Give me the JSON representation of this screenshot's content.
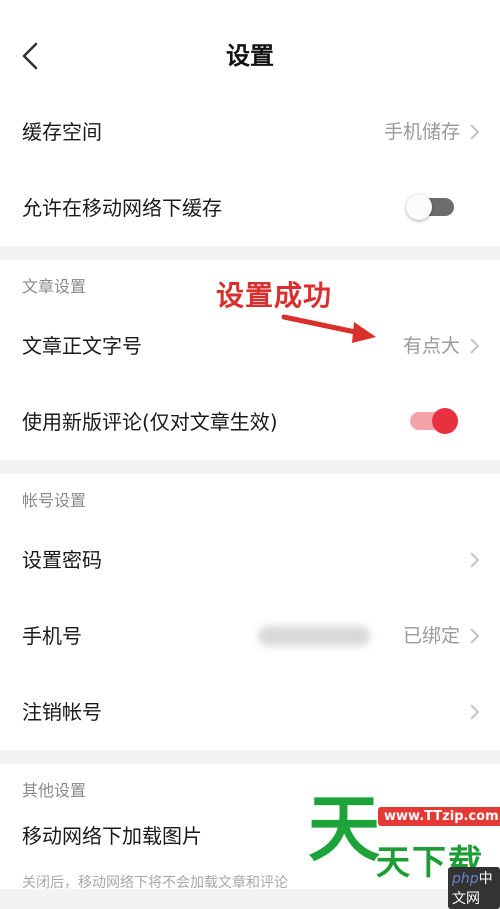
{
  "header": {
    "title": "设置"
  },
  "sections": {
    "general": {
      "cache_space": {
        "label": "缓存空间",
        "value": "手机储存"
      },
      "mobile_cache": {
        "label": "允许在移动网络下缓存",
        "enabled": false
      }
    },
    "article": {
      "heading": "文章设置",
      "font_size": {
        "label": "文章正文字号",
        "value": "有点大"
      },
      "new_comments": {
        "label": "使用新版评论(仅对文章生效)",
        "enabled": true
      }
    },
    "account": {
      "heading": "帐号设置",
      "set_password": {
        "label": "设置密码"
      },
      "phone": {
        "label": "手机号",
        "value": "已绑定"
      },
      "deregister": {
        "label": "注销帐号"
      }
    },
    "other": {
      "heading": "其他设置",
      "mobile_images": {
        "label": "移动网络下加载图片"
      },
      "footnote": "关闭后，移动网络下将不会加载文章和评论"
    }
  },
  "annotation": {
    "text": "设置成功",
    "color": "#d9302e"
  },
  "watermark": {
    "big": "天",
    "small": "天下载",
    "url": "www.TTzip.com"
  },
  "badge": {
    "php": "php",
    "rest": "中文网"
  },
  "colors": {
    "accent": "#e8313f",
    "toggle_on_track": "#f5a3ab",
    "toggle_off_track": "#6c6c6c"
  }
}
